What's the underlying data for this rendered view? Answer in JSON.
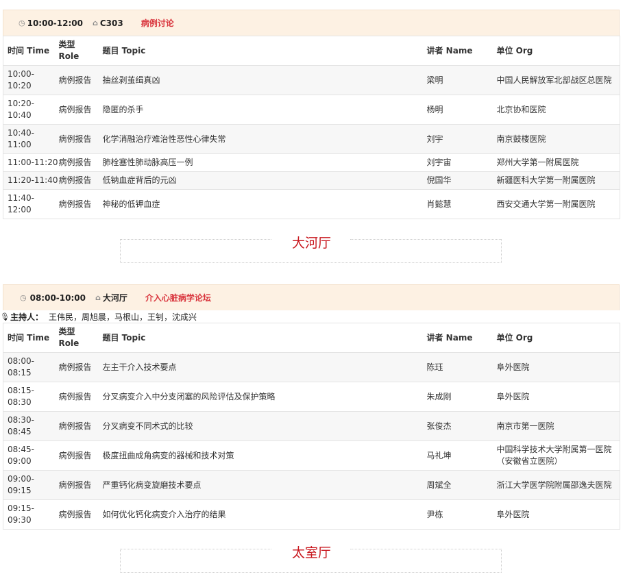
{
  "columns": {
    "time": "时间 Time",
    "role": "类型 Role",
    "topic": "题目 Topic",
    "speaker": "讲者 Name",
    "org": "单位 Org"
  },
  "session1": {
    "time": "10:00-12:00",
    "room": "C303",
    "topic": "病例讨论",
    "rows": [
      {
        "time": "10:00-10:20",
        "role": "病例报告",
        "topic": "抽丝剥茧缉真凶",
        "speaker": "梁明",
        "org": "中国人民解放军北部战区总医院"
      },
      {
        "time": "10:20-10:40",
        "role": "病例报告",
        "topic": "隐匿的杀手",
        "speaker": "杨明",
        "org": "北京协和医院"
      },
      {
        "time": "10:40-11:00",
        "role": "病例报告",
        "topic": "化学消融治疗难治性恶性心律失常",
        "speaker": "刘宇",
        "org": "南京鼓楼医院"
      },
      {
        "time": "11:00-11:20",
        "role": "病例报告",
        "topic": "肺栓塞性肺动脉高压一例",
        "speaker": "刘宇宙",
        "org": "郑州大学第一附属医院"
      },
      {
        "time": "11:20-11:40",
        "role": "病例报告",
        "topic": "低钠血症背后的元凶",
        "speaker": "倪国华",
        "org": "新疆医科大学第一附属医院"
      },
      {
        "time": "11:40-12:00",
        "role": "病例报告",
        "topic": "神秘的低钾血症",
        "speaker": "肖懿慧",
        "org": "西安交通大学第一附属医院"
      }
    ]
  },
  "hall1": "大河厅",
  "session2": {
    "time": "08:00-10:00",
    "room": "大河厅",
    "topic": "介入心脏病学论坛",
    "host_label": "主持人：",
    "hosts": "王伟民，周旭晨，马根山，王钊，沈成兴",
    "rows": [
      {
        "time": "08:00-08:15",
        "role": "病例报告",
        "topic": "左主干介入技术要点",
        "speaker": "陈珏",
        "org": "阜外医院"
      },
      {
        "time": "08:15-08:30",
        "role": "病例报告",
        "topic": "分叉病变介入中分支闭塞的风险评估及保护策略",
        "speaker": "朱成刚",
        "org": "阜外医院"
      },
      {
        "time": "08:30-08:45",
        "role": "病例报告",
        "topic": "分叉病变不同术式的比较",
        "speaker": "张俊杰",
        "org": "南京市第一医院"
      },
      {
        "time": "08:45-09:00",
        "role": "病例报告",
        "topic": "极度扭曲成角病变的器械和技术对策",
        "speaker": "马礼坤",
        "org": "中国科学技术大学附属第一医院（安徽省立医院）"
      },
      {
        "time": "09:00-09:15",
        "role": "病例报告",
        "topic": "严重钙化病变旋磨技术要点",
        "speaker": "周斌全",
        "org": "浙江大学医学院附属邵逸夫医院"
      },
      {
        "time": "09:15-09:30",
        "role": "病例报告",
        "topic": "如何优化钙化病变介入治疗的结果",
        "speaker": "尹栋",
        "org": "阜外医院"
      }
    ]
  },
  "hall2": "太室厅",
  "icons": {
    "clock": "clock-icon",
    "home": "home-icon",
    "mic": "microphone-icon"
  }
}
